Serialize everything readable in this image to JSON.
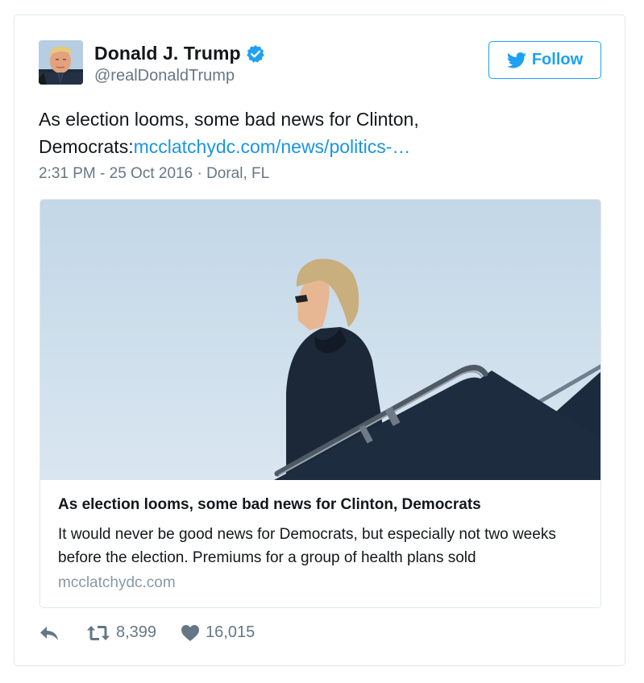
{
  "tweet": {
    "author": {
      "name": "Donald J. Trump",
      "handle": "@realDonaldTrump",
      "verified": true
    },
    "follow_label": "Follow",
    "text_prefix": "As election looms, some bad news for Clinton, Democrats:",
    "link_text": "mcclatchydc.com/news/politics-…",
    "time": "2:31 PM - 25 Oct 2016",
    "separator": " · ",
    "location": "Doral, FL",
    "card": {
      "title": "As election looms, some bad news for Clinton, Democrats",
      "description": "It would never be good news for Democrats, but especially not two weeks before the election. Premiums for a group of health plans sold",
      "domain": "mcclatchydc.com"
    },
    "stats": {
      "retweets": "8,399",
      "likes": "16,015"
    }
  },
  "colors": {
    "accent": "#1da1f2",
    "link": "#1b95e0",
    "muted": "#657786",
    "border": "#e1e8ed",
    "sky": "#c9dbe9"
  },
  "icons": {
    "verified": "verified-badge-icon",
    "follow": "twitter-bird-icon",
    "reply": "reply-icon",
    "retweet": "retweet-icon",
    "like": "heart-icon"
  }
}
